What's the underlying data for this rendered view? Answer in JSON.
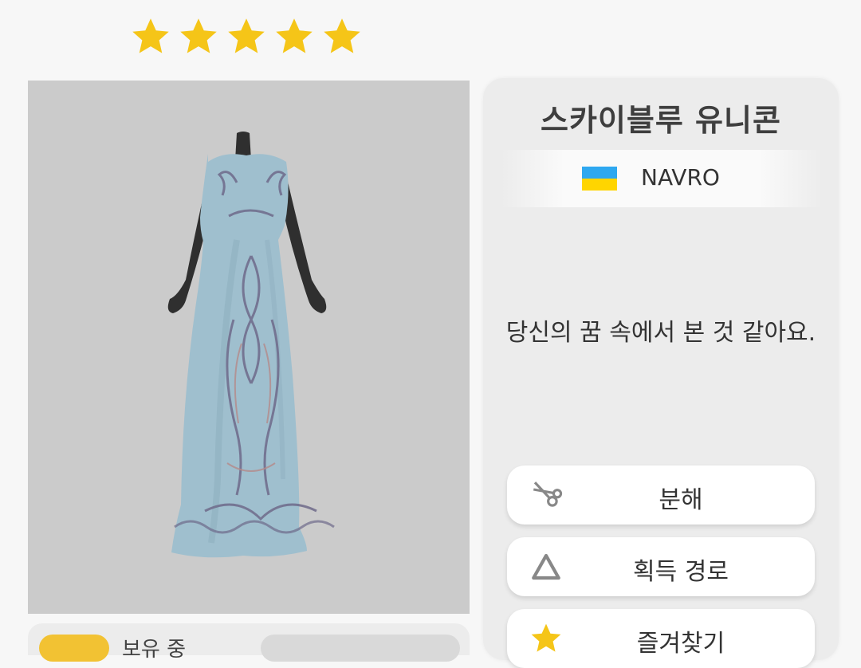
{
  "rating": {
    "stars": 5,
    "star_color": "#f5c518"
  },
  "item": {
    "name": "스카이블루 유니콘",
    "brand": {
      "name": "NAVRO",
      "flag_icon": "ukraine-flag-icon"
    },
    "description": "당신의 꿈 속에서 본 것 같아요."
  },
  "actions": [
    {
      "label": "분해",
      "icon": "scissors-icon"
    },
    {
      "label": "획득 경로",
      "icon": "triangle-icon"
    },
    {
      "label": "즐겨찾기",
      "icon": "star-icon"
    }
  ],
  "owned": {
    "label": "보유 중"
  },
  "colors": {
    "dress": "#9fbfce",
    "preview_bg": "#cbcbcb",
    "panel_bg": "#ececec"
  }
}
